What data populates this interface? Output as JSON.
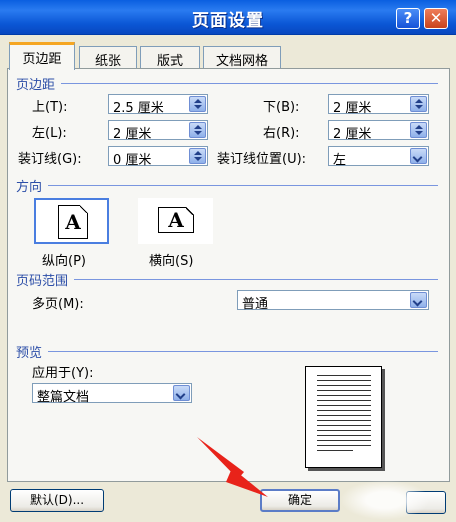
{
  "window": {
    "title": "页面设置"
  },
  "tabs": [
    {
      "label": "页边距",
      "active": true
    },
    {
      "label": "纸张",
      "active": false
    },
    {
      "label": "版式",
      "active": false
    },
    {
      "label": "文档网格",
      "active": false
    }
  ],
  "margins": {
    "header": "页边距",
    "top_label": "上(T):",
    "top_value": "2.5 厘米",
    "bottom_label": "下(B):",
    "bottom_value": "2 厘米",
    "left_label": "左(L):",
    "left_value": "2 厘米",
    "right_label": "右(R):",
    "right_value": "2 厘米",
    "gutter_label": "装订线(G):",
    "gutter_value": "0 厘米",
    "gutter_pos_label": "装订线位置(U):",
    "gutter_pos_value": "左"
  },
  "orientation": {
    "header": "方向",
    "portrait_label": "纵向(P)",
    "landscape_label": "横向(S)",
    "icon_letter": "A",
    "selected": "portrait"
  },
  "pages": {
    "header": "页码范围",
    "multi_label": "多页(M):",
    "multi_value": "普通"
  },
  "preview": {
    "header": "预览",
    "apply_label": "应用于(Y):",
    "apply_value": "整篇文档"
  },
  "buttons": {
    "default_label": "默认(D)...",
    "ok_label": "确定"
  },
  "colors": {
    "titlebar": "#0b57d6",
    "group_text": "#2d4fa8",
    "tab_highlight": "#f5a623",
    "arrow": "#e8231a"
  }
}
